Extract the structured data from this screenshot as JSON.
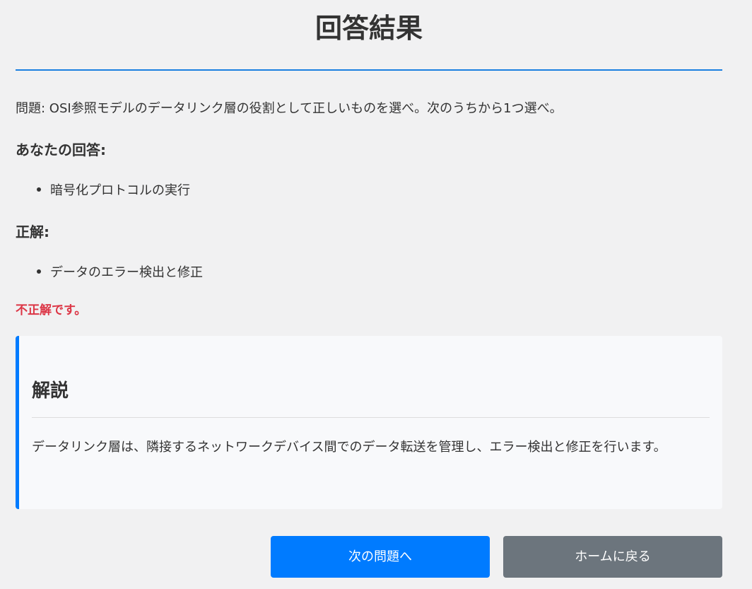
{
  "page": {
    "title": "回答結果"
  },
  "question": {
    "text": "問題: OSI参照モデルのデータリンク層の役割として正しいものを選べ。次のうちから1つ選べ。"
  },
  "your_answer": {
    "heading": "あなたの回答:",
    "items": [
      "暗号化プロトコルの実行"
    ]
  },
  "correct_answer": {
    "heading": "正解:",
    "items": [
      "データのエラー検出と修正"
    ]
  },
  "result": {
    "text": "不正解です。",
    "color": "#dc3545"
  },
  "explanation": {
    "heading": "解説",
    "text": "データリンク層は、隣接するネットワークデバイス間でのデータ転送を管理し、エラー検出と修正を行います。",
    "accent_color": "#007bff"
  },
  "buttons": {
    "next_label": "次の問題へ",
    "home_label": "ホームに戻る",
    "next_color": "#007bff",
    "home_color": "#6c757d"
  }
}
